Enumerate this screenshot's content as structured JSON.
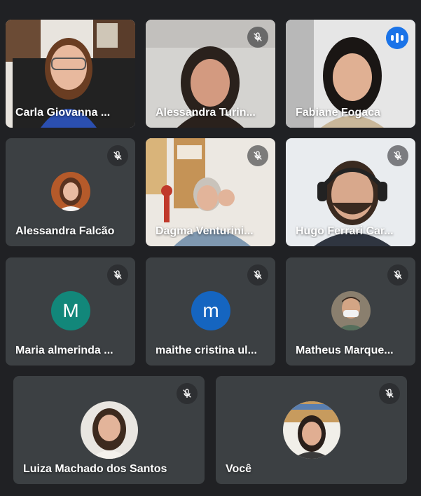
{
  "participants": [
    {
      "name": "Carla Giovanna ...",
      "muted": false
    },
    {
      "name": "Alessandra Turin...",
      "muted": true
    },
    {
      "name": "Fabiane Fogaca",
      "muted": false,
      "speaking": true
    },
    {
      "name": "Alessandra Falcão",
      "muted": true
    },
    {
      "name": "Dagma Venturini...",
      "muted": true
    },
    {
      "name": "Hugo Ferrari Car...",
      "muted": true
    },
    {
      "name": "Maria almerinda ...",
      "muted": true,
      "initial": "M",
      "avatar_color": "#12877a"
    },
    {
      "name": "maithe cristina ul...",
      "muted": true,
      "initial": "m",
      "avatar_color": "#1565c0"
    },
    {
      "name": "Matheus Marque...",
      "muted": true
    },
    {
      "name": "Luiza Machado dos Santos",
      "muted": true
    },
    {
      "name": "Você",
      "muted": true
    }
  ],
  "colors": {
    "background": "#202124",
    "tile": "#3c4043",
    "active_border": "#8ab4f8",
    "speaking": "#1a73e8"
  }
}
